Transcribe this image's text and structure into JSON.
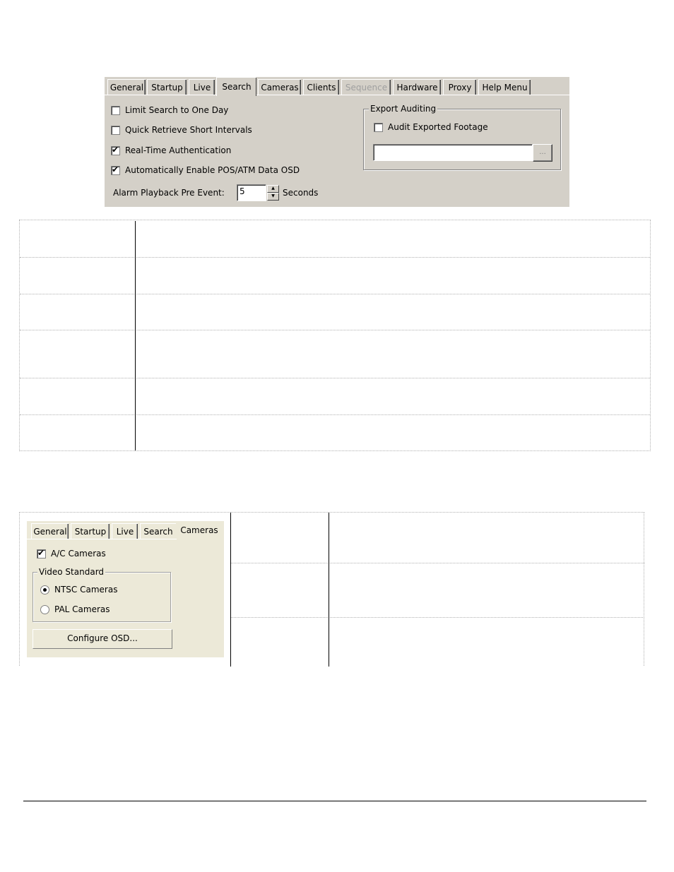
{
  "search_dialog": {
    "tabs": [
      {
        "label": "General",
        "state": "normal"
      },
      {
        "label": "Startup",
        "state": "normal"
      },
      {
        "label": "Live",
        "state": "normal"
      },
      {
        "label": "Search",
        "state": "active"
      },
      {
        "label": "Cameras",
        "state": "normal"
      },
      {
        "label": "Clients",
        "state": "normal"
      },
      {
        "label": "Sequence",
        "state": "disabled"
      },
      {
        "label": "Hardware",
        "state": "normal"
      },
      {
        "label": "Proxy",
        "state": "normal"
      },
      {
        "label": "Help Menu",
        "state": "normal"
      }
    ],
    "options": [
      {
        "label": "Limit Search to One Day",
        "checked": false
      },
      {
        "label": "Quick Retrieve Short Intervals",
        "checked": false
      },
      {
        "label": "Real-Time Authentication",
        "checked": true
      },
      {
        "label": "Automatically Enable POS/ATM Data OSD",
        "checked": true
      }
    ],
    "alarm_playback": {
      "label": "Alarm Playback Pre Event:",
      "value": "5",
      "unit": "Seconds"
    },
    "export_auditing": {
      "legend": "Export Auditing",
      "audit_label": "Audit Exported Footage",
      "audit_checked": false,
      "path_value": "",
      "browse_label": "..."
    },
    "tick_glyph": "✔",
    "bg_color": "#d4d0c8"
  },
  "table1": {
    "rows": [
      {
        "term": "",
        "description": ""
      },
      {
        "term": "",
        "description": ""
      },
      {
        "term": "",
        "description": ""
      },
      {
        "term": "",
        "description": ""
      },
      {
        "term": "",
        "description": ""
      },
      {
        "term": "",
        "description": ""
      }
    ]
  },
  "cameras_dialog": {
    "tabs": [
      {
        "label": "General",
        "state": "normal"
      },
      {
        "label": "Startup",
        "state": "normal"
      },
      {
        "label": "Live",
        "state": "normal"
      },
      {
        "label": "Search",
        "state": "normal"
      },
      {
        "label": "Cameras",
        "state": "active"
      }
    ],
    "ac_cameras": {
      "label": "A/C Cameras",
      "checked": true
    },
    "video_standard": {
      "legend": "Video Standard",
      "options": [
        {
          "label": "NTSC Cameras",
          "selected": true
        },
        {
          "label": "PAL Cameras",
          "selected": false
        }
      ]
    },
    "configure_osd_label": "Configure OSD...",
    "bg_color": "#ece9d8"
  },
  "table2": {
    "rows": [
      {
        "term": "",
        "description": ""
      },
      {
        "term": "",
        "description": ""
      },
      {
        "term": "",
        "description": ""
      }
    ]
  }
}
